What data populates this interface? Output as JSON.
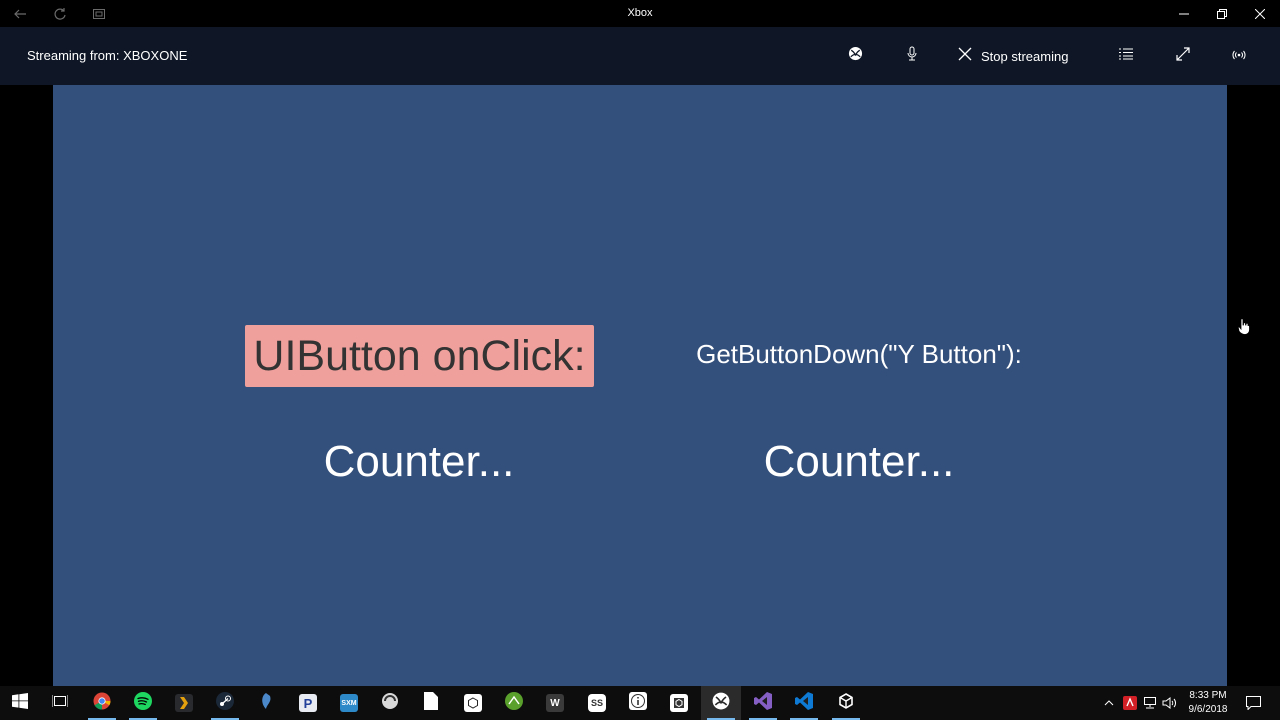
{
  "window": {
    "title": "Xbox"
  },
  "stream": {
    "label": "Streaming from: XBOXONE",
    "stop_label": "Stop streaming"
  },
  "game": {
    "ui_button_label": "UIButton onClick:",
    "getbutton_label": "GetButtonDown(\"Y Button\"):",
    "counter_left": "Counter...",
    "counter_right": "Counter..."
  },
  "colors": {
    "game_bg": "#334f7b",
    "button_bg": "#f0a09c",
    "header_bg": "#0f1726"
  },
  "taskbar": {
    "apps": [
      {
        "name": "task-view"
      },
      {
        "name": "chrome"
      },
      {
        "name": "spotify"
      },
      {
        "name": "plex"
      },
      {
        "name": "steam"
      },
      {
        "name": "app-swirl"
      },
      {
        "name": "pandora",
        "letter": "P"
      },
      {
        "name": "siriusxm",
        "letter": "SXM"
      },
      {
        "name": "app-circle"
      },
      {
        "name": "file"
      },
      {
        "name": "unity"
      },
      {
        "name": "xbox-app-green"
      },
      {
        "name": "word-w",
        "letter": "W"
      },
      {
        "name": "ss-app",
        "letter": "SS"
      },
      {
        "name": "info-app"
      },
      {
        "name": "unity-box"
      },
      {
        "name": "xbox"
      },
      {
        "name": "visual-studio"
      },
      {
        "name": "vscode"
      },
      {
        "name": "unity-editor"
      }
    ],
    "clock_time": "8:33 PM",
    "clock_date": "9/6/2018"
  }
}
